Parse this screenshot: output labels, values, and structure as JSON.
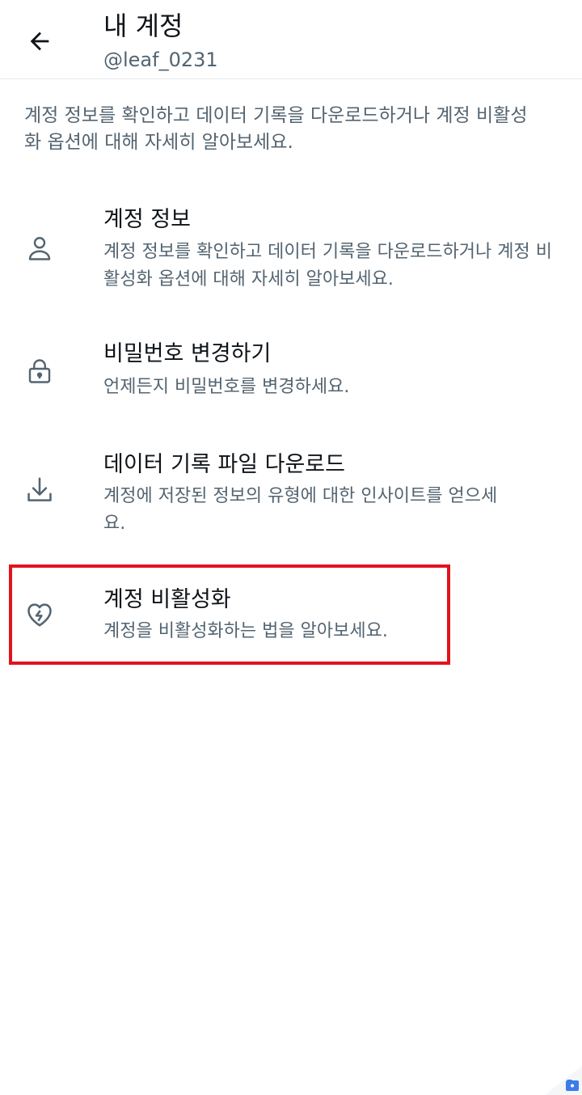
{
  "header": {
    "title": "내 계정",
    "subtitle": "@leaf_0231",
    "back_icon": "arrow-left-icon"
  },
  "intro": {
    "text": "계정 정보를 확인하고 데이터 기록을 다운로드하거나 계정 비활성화 옵션에 대해 자세히 알아보세요."
  },
  "items": [
    {
      "icon": "person-icon",
      "title": "계정 정보",
      "description": "계정 정보를 확인하고 데이터 기록을 다운로드하거나 계정 비활성화 옵션에 대해 자세히 알아보세요."
    },
    {
      "icon": "lock-icon",
      "title": "비밀번호 변경하기",
      "description": "언제든지 비밀번호를 변경하세요."
    },
    {
      "icon": "download-icon",
      "title": "데이터 기록 파일 다운로드",
      "description": "계정에 저장된 정보의 유형에 대한 인사이트를 얻으세요."
    },
    {
      "icon": "broken-heart-icon",
      "title": "계정 비활성화",
      "description": "계정을 비활성화하는 법을 알아보세요."
    }
  ],
  "colors": {
    "primary_text": "#0f1419",
    "secondary_text": "#536471",
    "highlight": "#e0141e",
    "divider": "#e6e9ec"
  }
}
